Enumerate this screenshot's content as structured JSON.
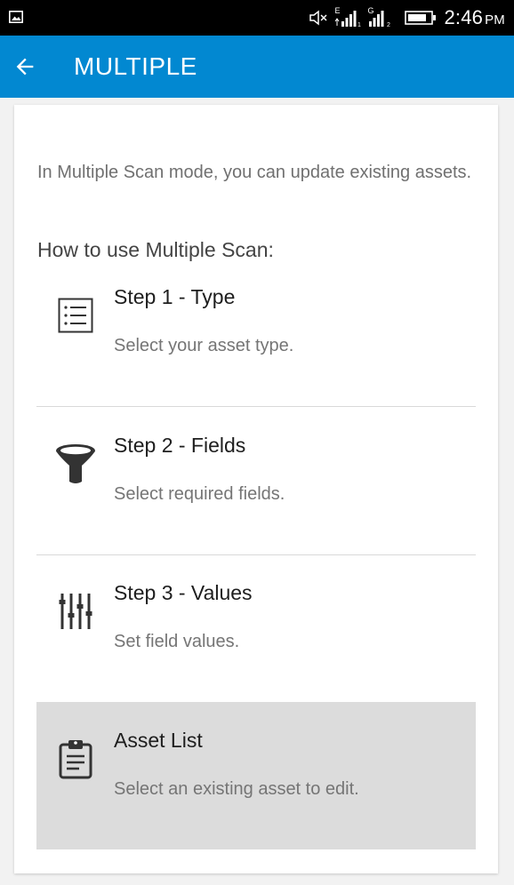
{
  "status_bar": {
    "time": "2:46",
    "meridiem": "PM",
    "sim1_network": "E",
    "sim2_network": "G",
    "icons": [
      "gallery-icon",
      "mute-icon",
      "signal-sim1-icon",
      "signal-sim2-icon",
      "battery-icon"
    ]
  },
  "app_bar": {
    "title": "MULTIPLE",
    "back_icon": "arrow-back-icon",
    "color": "#0288d1"
  },
  "intro": {
    "text": "In Multiple Scan mode, you can update existing assets.",
    "howto": "How to use Multiple Scan:"
  },
  "steps": [
    {
      "title": "Step 1 - Type",
      "description": "Select your asset type.",
      "icon": "list-icon"
    },
    {
      "title": "Step 2 - Fields",
      "description": "Select required fields.",
      "icon": "filter-funnel-icon"
    },
    {
      "title": "Step 3 - Values",
      "description": "Set field values.",
      "icon": "sliders-icon"
    },
    {
      "title": "Asset List",
      "description": "Select an existing asset to edit.",
      "icon": "clipboard-icon",
      "selected": true
    }
  ]
}
